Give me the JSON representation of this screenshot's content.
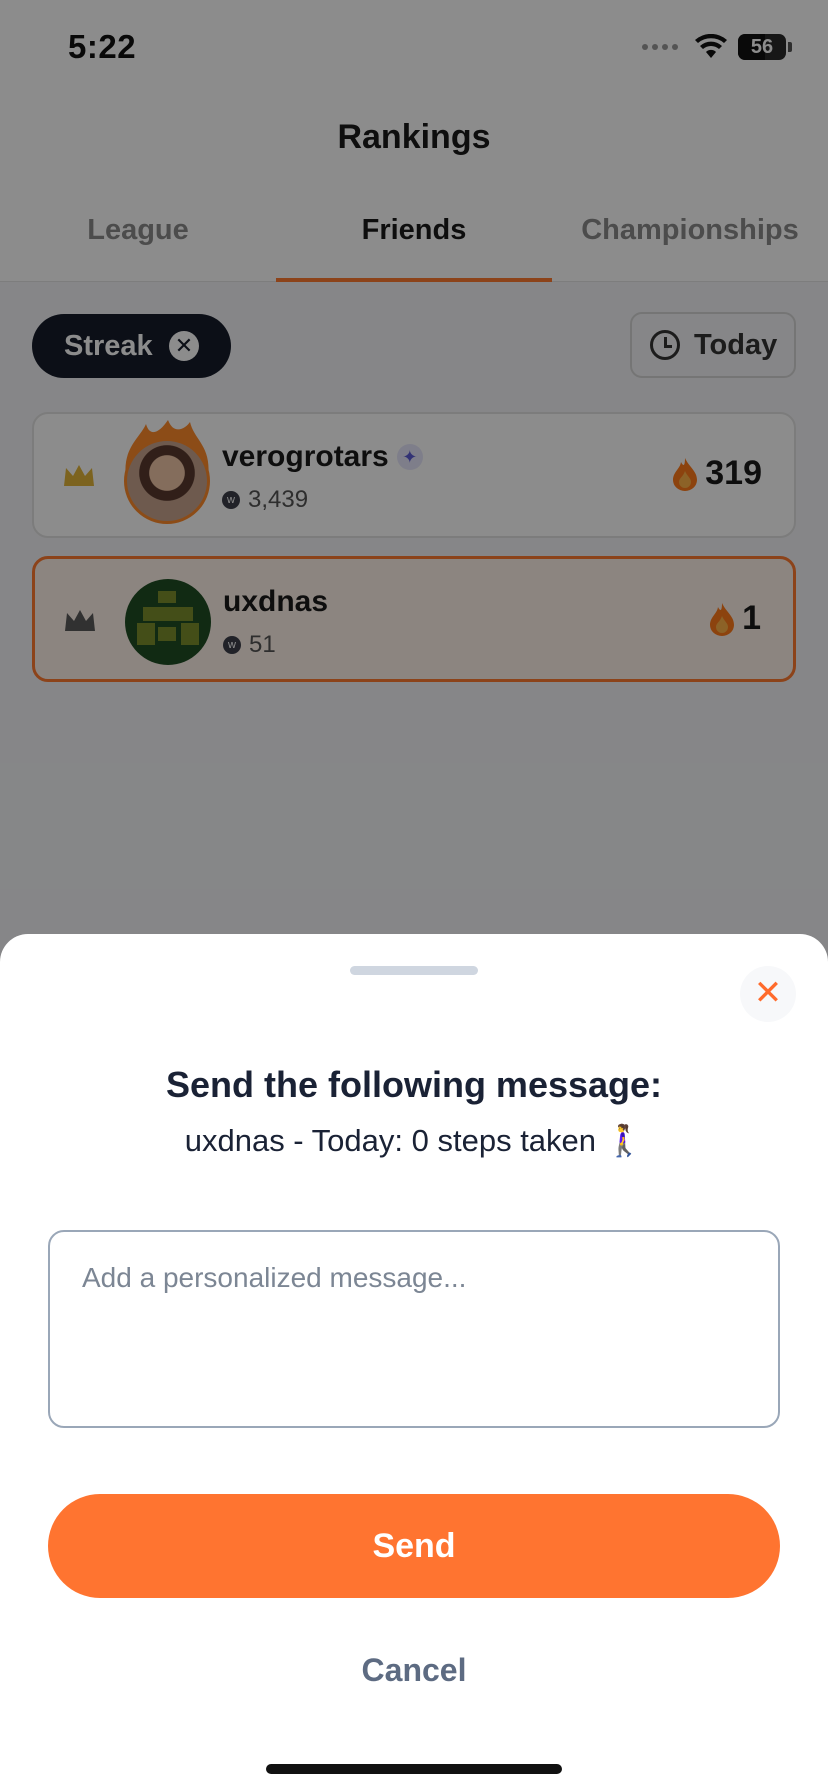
{
  "status_bar": {
    "time": "5:22",
    "battery": "56",
    "battery_level": 0.56
  },
  "header": {
    "title": "Rankings"
  },
  "tabs": [
    {
      "label": "League",
      "active": false
    },
    {
      "label": "Friends",
      "active": true
    },
    {
      "label": "Championships",
      "active": false
    }
  ],
  "filters": {
    "chip_label": "Streak",
    "period_label": "Today"
  },
  "rankings": [
    {
      "name": "verogrotars",
      "points": "3,439",
      "streak": "319",
      "verified": true
    },
    {
      "name": "uxdnas",
      "points": "51",
      "streak": "1",
      "verified": false
    }
  ],
  "sheet": {
    "title": "Send the following message:",
    "subtitle": "uxdnas - Today: 0 steps taken 🚶‍♀️",
    "input_placeholder": "Add a personalized message...",
    "input_value": "",
    "send_label": "Send",
    "cancel_label": "Cancel"
  },
  "colors": {
    "accent": "#ff7430",
    "dark": "#161c2b",
    "overlay": "rgba(0,0,0,0.45)"
  },
  "icons": [
    "wifi-icon",
    "battery-icon",
    "clock-icon",
    "close-icon",
    "crown-icon",
    "coin-icon",
    "fire-icon",
    "sparkle-icon"
  ]
}
